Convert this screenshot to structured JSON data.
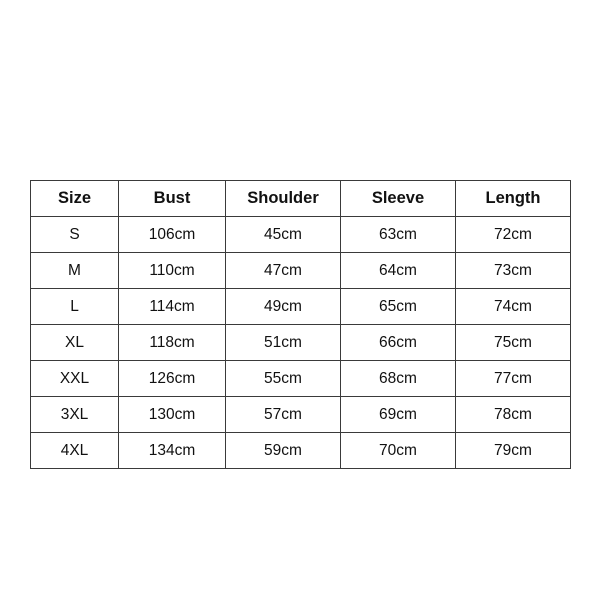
{
  "table": {
    "headers": [
      "Size",
      "Bust",
      "Shoulder",
      "Sleeve",
      "Length"
    ],
    "rows": [
      {
        "size": "S",
        "bust": "106cm",
        "shoulder": "45cm",
        "sleeve": "63cm",
        "length": "72cm"
      },
      {
        "size": "M",
        "bust": "110cm",
        "shoulder": "47cm",
        "sleeve": "64cm",
        "length": "73cm"
      },
      {
        "size": "L",
        "bust": "114cm",
        "shoulder": "49cm",
        "sleeve": "65cm",
        "length": "74cm"
      },
      {
        "size": "XL",
        "bust": "118cm",
        "shoulder": "51cm",
        "sleeve": "66cm",
        "length": "75cm"
      },
      {
        "size": "XXL",
        "bust": "126cm",
        "shoulder": "55cm",
        "sleeve": "68cm",
        "length": "77cm"
      },
      {
        "size": "3XL",
        "bust": "130cm",
        "shoulder": "57cm",
        "sleeve": "69cm",
        "length": "78cm"
      },
      {
        "size": "4XL",
        "bust": "134cm",
        "shoulder": "59cm",
        "sleeve": "70cm",
        "length": "79cm"
      }
    ]
  },
  "colors": {
    "page_background": "#ffffff",
    "table_background": "#ffffff",
    "border": "#3a3a3a",
    "text": "#111111"
  }
}
